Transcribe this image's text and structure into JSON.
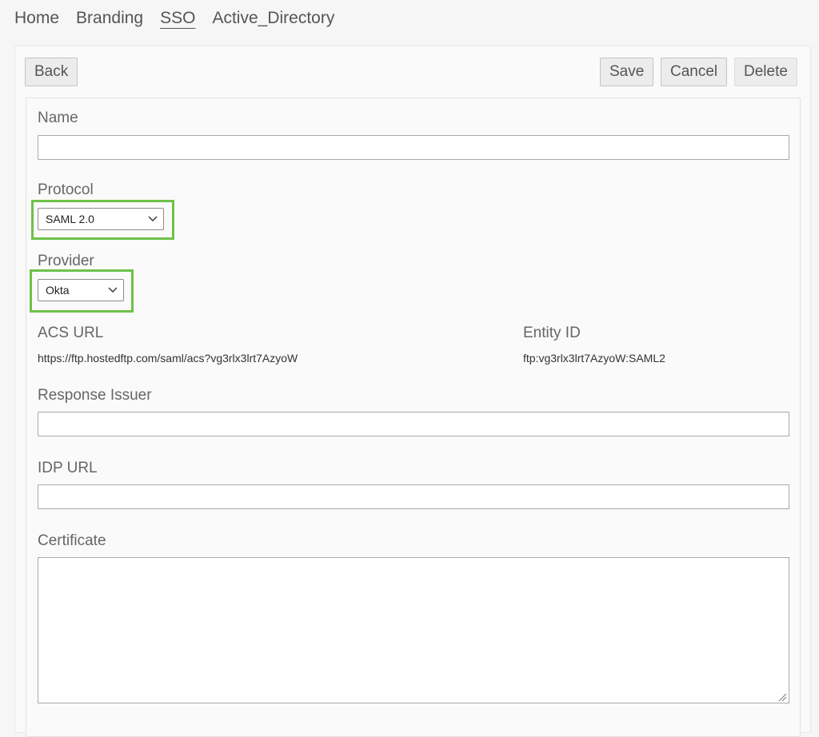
{
  "nav": {
    "home": "Home",
    "branding": "Branding",
    "sso": "SSO",
    "active_directory": "Active_Directory"
  },
  "toolbar": {
    "back": "Back",
    "save": "Save",
    "cancel": "Cancel",
    "delete": "Delete"
  },
  "form": {
    "name_label": "Name",
    "name_value": "",
    "protocol_label": "Protocol",
    "protocol_selected": "SAML 2.0",
    "provider_label": "Provider",
    "provider_selected": "Okta",
    "acs_url_label": "ACS URL",
    "acs_url_value": "https://ftp.hostedftp.com/saml/acs?vg3rlx3lrt7AzyoW",
    "entity_id_label": "Entity ID",
    "entity_id_value": "ftp:vg3rlx3lrt7AzyoW:SAML2",
    "response_issuer_label": "Response Issuer",
    "response_issuer_value": "",
    "idp_url_label": "IDP URL",
    "idp_url_value": "",
    "certificate_label": "Certificate",
    "certificate_value": ""
  },
  "colors": {
    "highlight": "#6cc24a"
  },
  "icons": {
    "dropdown": "chevron-down-icon",
    "resize": "resize-grip-icon"
  }
}
